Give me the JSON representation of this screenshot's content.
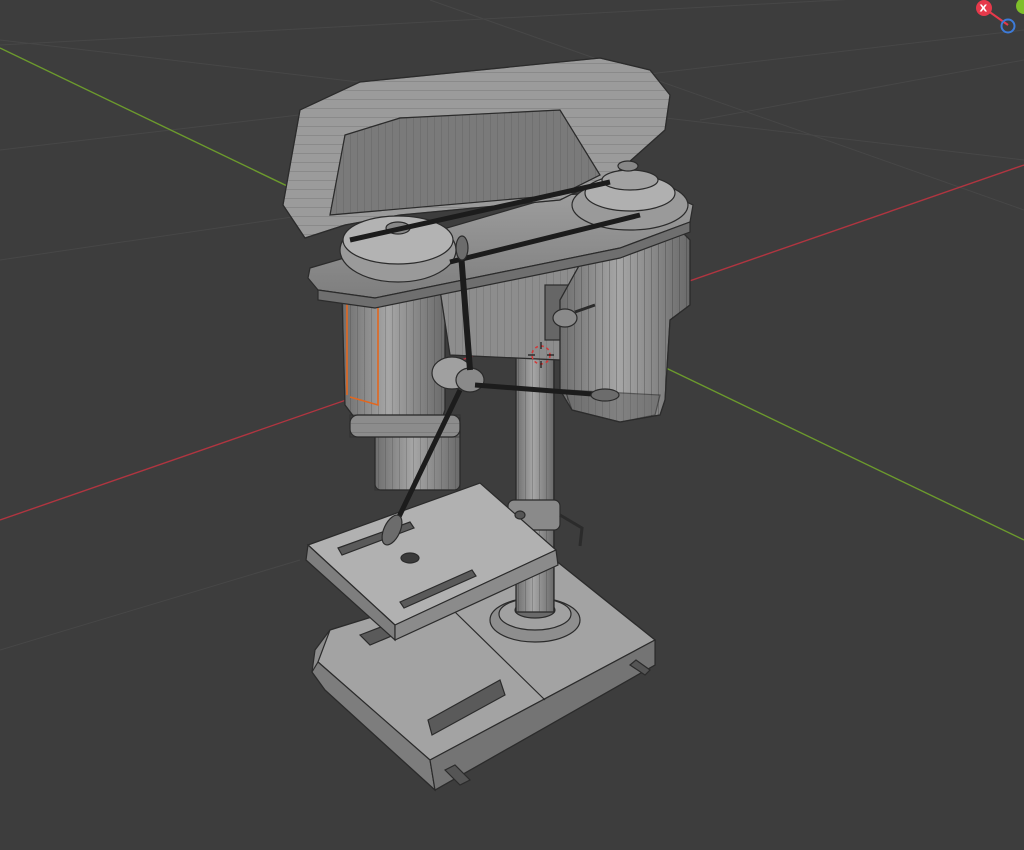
{
  "viewport": {
    "background": "#3d3d3d",
    "grid_color": "#4a4a4a",
    "x_axis_color": "#b03540",
    "y_axis_color": "#6c9a2d"
  },
  "gizmo": {
    "x_label": "X",
    "x_color": "#e6394b",
    "y_color": "#7fbf2a",
    "z_color": "#3d7bd9"
  },
  "model": {
    "icon": "drill-press-icon",
    "body_color": "#8a8a8a",
    "wire_color": "#2b2b2b",
    "selection_color": "#e2671f",
    "cursor_color": "#d23a3a"
  }
}
